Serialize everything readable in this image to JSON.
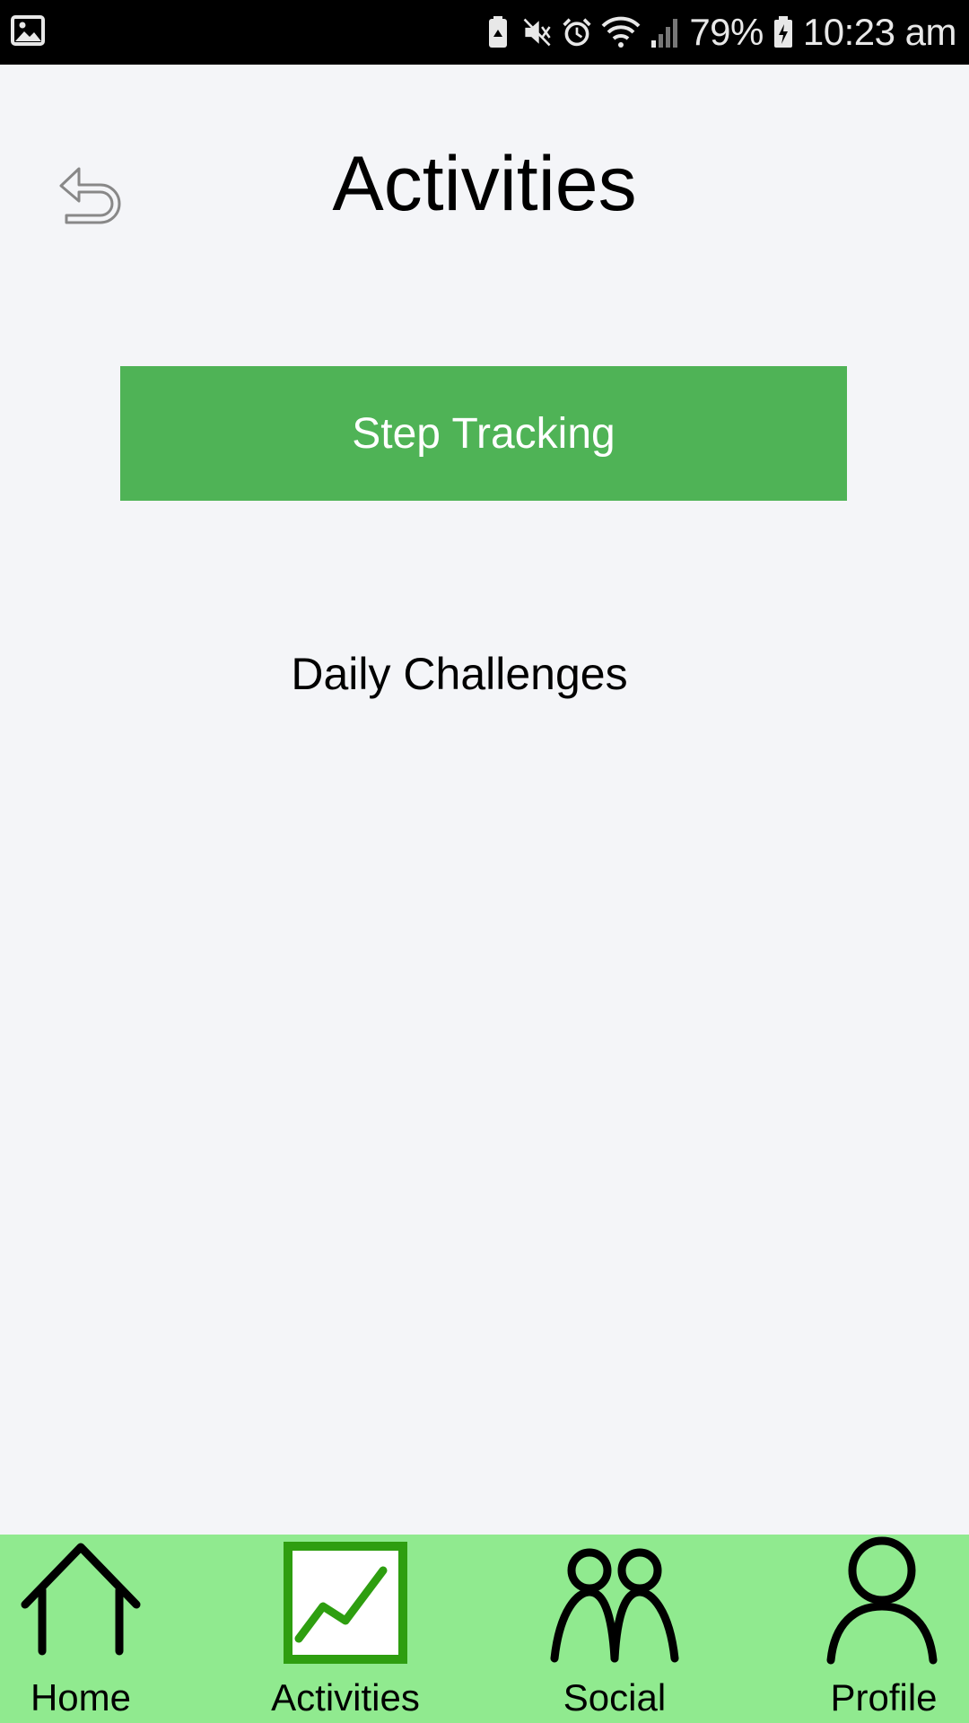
{
  "status_bar": {
    "battery_percent": "79%",
    "time": "10:23 am",
    "icons": [
      "image-icon",
      "battery-saver-icon",
      "mute-icon",
      "alarm-icon",
      "wifi-icon",
      "signal-icon",
      "battery-icon"
    ]
  },
  "header": {
    "title": "Activities",
    "back_icon": "back-arrow-icon"
  },
  "main": {
    "step_tracking_label": "Step Tracking",
    "daily_challenges_label": "Daily Challenges"
  },
  "bottom_nav": {
    "items": [
      {
        "label": "Home",
        "icon": "house-icon"
      },
      {
        "label": "Activities",
        "icon": "chart-icon",
        "active": true
      },
      {
        "label": "Social",
        "icon": "people-icon"
      },
      {
        "label": "Profile",
        "icon": "person-icon"
      }
    ]
  },
  "colors": {
    "status_bar_bg": "#000000",
    "page_bg": "#f4f5f8",
    "button_green": "#4fb356",
    "nav_bg": "#90ea8f",
    "active_icon_green": "#2e9e10"
  }
}
